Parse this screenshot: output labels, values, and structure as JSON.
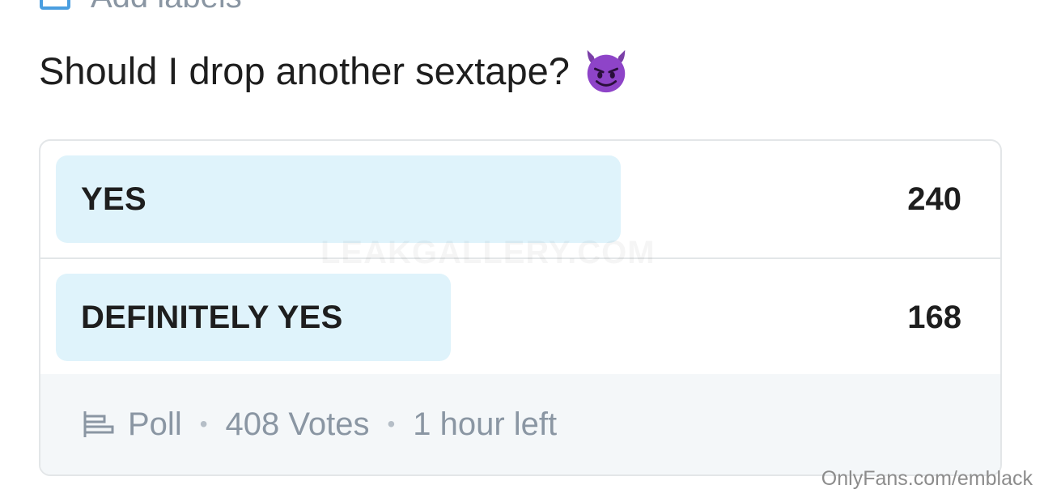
{
  "top": {
    "label": "Add labels",
    "icon": "label-icon"
  },
  "post": {
    "text": "Should I drop another sextape?",
    "emoji": "smiling-devil-emoji"
  },
  "poll": {
    "options": [
      {
        "label": "YES",
        "votes": "240",
        "fraction": 0.588
      },
      {
        "label": "DEFINITELY YES",
        "votes": "168",
        "fraction": 0.412
      }
    ],
    "footer": {
      "icon": "poll-icon",
      "type": "Poll",
      "separator": "•",
      "votes": "408 Votes",
      "time_left": "1 hour left"
    },
    "colors": {
      "fill": "#dff3fb",
      "border": "#e3e6e8",
      "footer_bg": "#f4f7f9",
      "muted": "#8a96a3"
    }
  },
  "watermarks": {
    "site": "LEAKGALLERY.COM",
    "source": "OnlyFans.com/emblack"
  }
}
